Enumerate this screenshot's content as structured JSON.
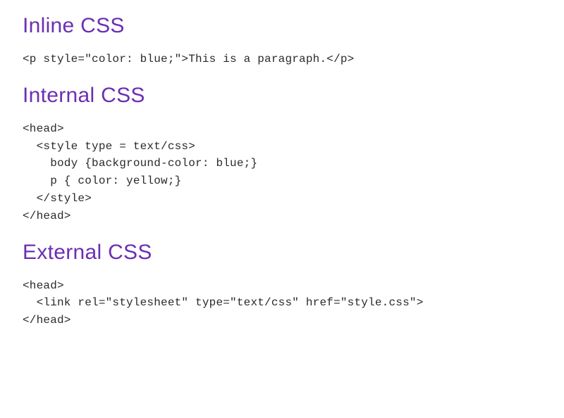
{
  "sections": {
    "inline": {
      "title": "Inline CSS",
      "code": "<p style=\"color: blue;\">This is a paragraph.</p>"
    },
    "internal": {
      "title": "Internal CSS",
      "code": "<head>\n  <style type = text/css>\n    body {background-color: blue;}\n    p { color: yellow;}\n  </style>\n</head>"
    },
    "external": {
      "title": "External CSS",
      "code": "<head>\n  <link rel=\"stylesheet\" type=\"text/css\" href=\"style.css\">\n</head>"
    }
  }
}
